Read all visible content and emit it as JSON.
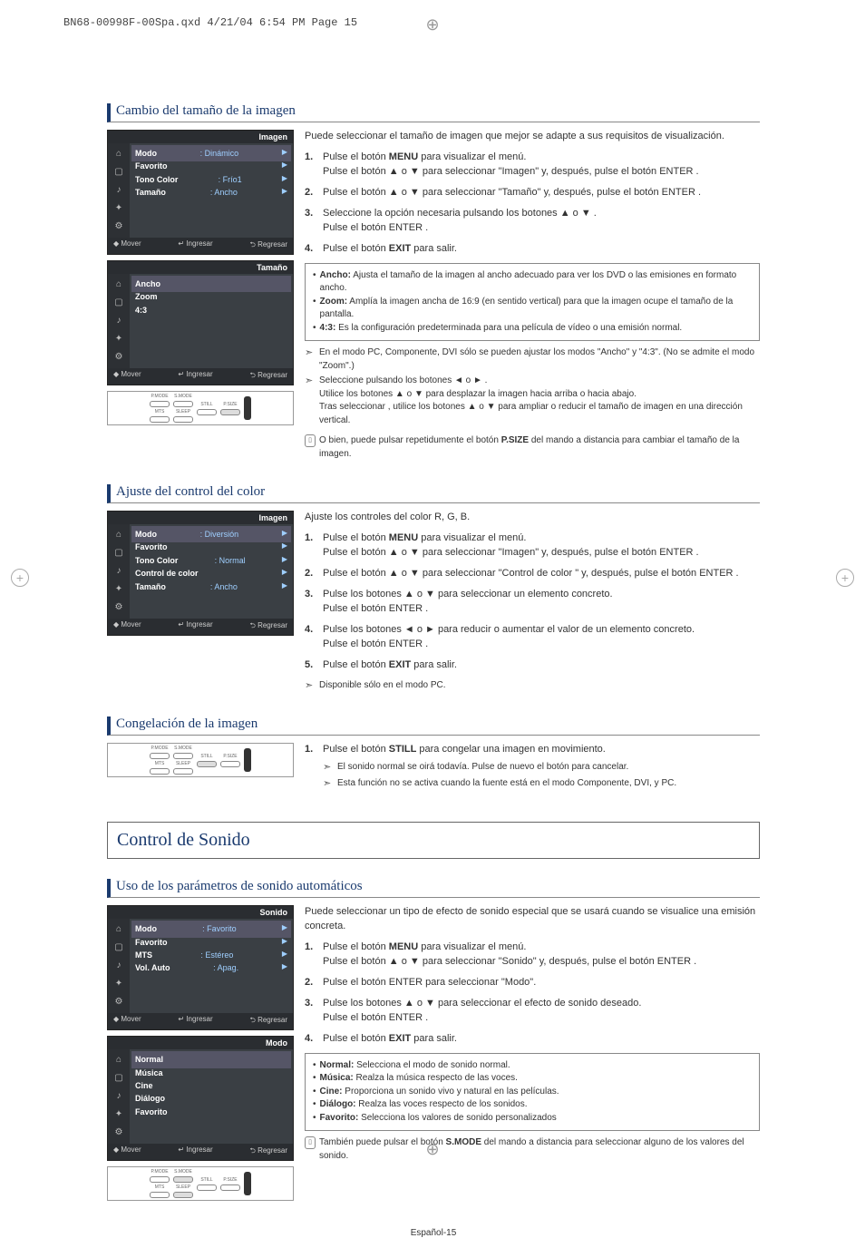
{
  "header": {
    "filename": "BN68-00998F-00Spa.qxd  4/21/04  6:54 PM  Page 15"
  },
  "page_number": "Español-15",
  "sections": {
    "picture_size": {
      "title": "Cambio del tamaño de la imagen",
      "osd1": {
        "title_bar": "Imagen",
        "rows": [
          {
            "label": "Modo",
            "value": ": Dinámico"
          },
          {
            "label": "Favorito",
            "value": ""
          },
          {
            "label": "Tono Color",
            "value": ": Frío1"
          },
          {
            "label": "Tamaño",
            "value": ": Ancho"
          }
        ],
        "footer": {
          "move": "Mover",
          "enter": "Ingresar",
          "back": "Regresar"
        }
      },
      "osd2": {
        "title_bar": "Tamaño",
        "rows": [
          {
            "label": "Ancho"
          },
          {
            "label": "Zoom"
          },
          {
            "label": "4:3"
          }
        ],
        "footer": {
          "move": "Mover",
          "enter": "Ingresar",
          "back": "Regresar"
        }
      },
      "remote_labels": {
        "pmode": "P.MODE",
        "smode": "S.MODE",
        "still": "STILL",
        "psize": "P.SIZE",
        "mts": "MTS",
        "sleep": "SLEEP"
      },
      "intro": "Puede seleccionar el tamaño de imagen que mejor se adapte a sus requisitos de visualización.",
      "steps": [
        {
          "n": "1.",
          "text": "Pulse el botón MENU para visualizar el menú.",
          "text2": "Pulse el botón ▲ o ▼ para seleccionar \"Imagen\" y, después, pulse el botón ENTER ."
        },
        {
          "n": "2.",
          "text": "Pulse el botón ▲ o ▼ para seleccionar \"Tamaño\" y, después, pulse el botón ENTER ."
        },
        {
          "n": "3.",
          "text": "Seleccione la opción necesaria pulsando los botones ▲ o ▼ .",
          "text2": "Pulse el botón ENTER ."
        },
        {
          "n": "4.",
          "text": "Pulse el botón EXIT para salir."
        }
      ],
      "box": [
        {
          "b": "Ancho:",
          "t": "Ajusta el tamaño de la imagen al ancho adecuado para ver los DVD o las emisiones en formato ancho."
        },
        {
          "b": "Zoom:",
          "t": "Amplía la imagen ancha de 16:9 (en sentido vertical) para que la imagen ocupe el tamaño de la pantalla."
        },
        {
          "b": "4:3:",
          "t": "Es la configuración predeterminada para una película de vídeo o una emisión normal."
        }
      ],
      "notes": [
        "En el modo PC, Componente, DVI sólo se pueden ajustar los modos \"Ancho\" y \"4:3\". (No se admite el modo \"Zoom\".)",
        "Seleccione  pulsando los botones ◄ o ► .",
        "Utilice los botones ▲ o ▼ para desplazar la imagen hacia arriba o hacia abajo.",
        "Tras seleccionar  , utilice los botones ▲ o ▼ para ampliar o reducir el tamaño de imagen en una dirección vertical."
      ],
      "remote_note": "O bien, puede pulsar repetidumente el botón P.SIZE del mando a distancia para cambiar el tamaño de la imagen."
    },
    "color_control": {
      "title": "Ajuste del control del color",
      "osd1": {
        "title_bar": "Imagen",
        "rows": [
          {
            "label": "Modo",
            "value": ": Diversión"
          },
          {
            "label": "Favorito",
            "value": ""
          },
          {
            "label": "Tono Color",
            "value": ": Normal"
          },
          {
            "label": "Control de color",
            "value": ""
          },
          {
            "label": "Tamaño",
            "value": ": Ancho"
          }
        ],
        "footer": {
          "move": "Mover",
          "enter": "Ingresar",
          "back": "Regresar"
        }
      },
      "intro": "Ajuste los controles del color R, G, B.",
      "steps": [
        {
          "n": "1.",
          "text": "Pulse el botón MENU para visualizar el menú.",
          "text2": "Pulse el botón ▲ o ▼ para seleccionar \"Imagen\" y, después, pulse el botón ENTER ."
        },
        {
          "n": "2.",
          "text": "Pulse el botón ▲ o ▼ para seleccionar \"Control de color \" y, después, pulse el botón ENTER ."
        },
        {
          "n": "3.",
          "text": "Pulse los botones ▲ o ▼ para seleccionar un elemento concreto.",
          "text2": "Pulse el botón ENTER ."
        },
        {
          "n": "4.",
          "text": "Pulse los botones ◄ o ► para reducir o aumentar el valor de un elemento concreto.",
          "text2": "Pulse el botón ENTER ."
        },
        {
          "n": "5.",
          "text": "Pulse el botón EXIT para salir."
        }
      ],
      "note": "Disponible sólo en el modo PC."
    },
    "freeze": {
      "title": "Congelación de la imagen",
      "steps": [
        {
          "n": "1.",
          "text": "Pulse el botón STILL para congelar una imagen en movimiento."
        }
      ],
      "notes": [
        "El sonido normal se oirá todavía. Pulse de nuevo el botón para cancelar.",
        "Esta función no se activa cuando la fuente está en el modo Componente, DVI, y PC."
      ]
    },
    "sound_heading": "Control de Sonido",
    "sound_auto": {
      "title": "Uso de los parámetros de sonido automáticos",
      "osd1": {
        "title_bar": "Sonido",
        "rows": [
          {
            "label": "Modo",
            "value": ": Favorito"
          },
          {
            "label": "Favorito",
            "value": ""
          },
          {
            "label": "MTS",
            "value": ": Estéreo"
          },
          {
            "label": "Vol. Auto",
            "value": ": Apag."
          }
        ],
        "footer": {
          "move": "Mover",
          "enter": "Ingresar",
          "back": "Regresar"
        }
      },
      "osd2": {
        "title_bar": "Modo",
        "rows": [
          {
            "label": "Normal"
          },
          {
            "label": "Música"
          },
          {
            "label": "Cine"
          },
          {
            "label": "Diálogo"
          },
          {
            "label": "Favorito"
          }
        ],
        "footer": {
          "move": "Mover",
          "enter": "Ingresar",
          "back": "Regresar"
        }
      },
      "intro": "Puede seleccionar un tipo de efecto de sonido especial que se usará cuando se visualice una emisión concreta.",
      "steps": [
        {
          "n": "1.",
          "text": "Pulse el botón MENU para visualizar el menú.",
          "text2": "Pulse el botón ▲ o ▼ para seleccionar \"Sonido\" y, después, pulse el botón ENTER ."
        },
        {
          "n": "2.",
          "text": "Pulse el botón ENTER  para seleccionar \"Modo\"."
        },
        {
          "n": "3.",
          "text": "Pulse los botones ▲ o ▼ para seleccionar el efecto de sonido deseado.",
          "text2": "Pulse el botón ENTER ."
        },
        {
          "n": "4.",
          "text": "Pulse el botón EXIT para salir."
        }
      ],
      "box": [
        {
          "b": "Normal:",
          "t": "Selecciona el modo de sonido normal."
        },
        {
          "b": "Música:",
          "t": "Realza la música respecto de las voces."
        },
        {
          "b": "Cine:",
          "t": "Proporciona un sonido vivo y natural en las películas."
        },
        {
          "b": "Diálogo:",
          "t": "Realza las voces respecto de los sonidos."
        },
        {
          "b": "Favorito:",
          "t": "Selecciona los valores de sonido personalizados"
        }
      ],
      "remote_note": "También puede pulsar el botón S.MODE del mando a distancia para seleccionar alguno de los valores del sonido."
    }
  }
}
